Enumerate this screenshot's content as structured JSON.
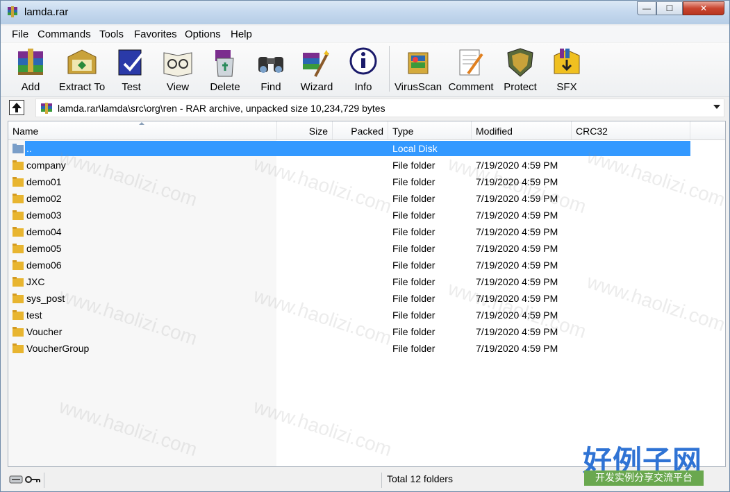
{
  "window": {
    "title": "lamda.rar"
  },
  "menu": [
    "File",
    "Commands",
    "Tools",
    "Favorites",
    "Options",
    "Help"
  ],
  "toolbar": [
    {
      "label": "Add",
      "icon": "add-icon"
    },
    {
      "label": "Extract To",
      "icon": "extract-icon"
    },
    {
      "label": "Test",
      "icon": "test-icon"
    },
    {
      "label": "View",
      "icon": "view-icon"
    },
    {
      "label": "Delete",
      "icon": "delete-icon"
    },
    {
      "label": "Find",
      "icon": "find-icon"
    },
    {
      "label": "Wizard",
      "icon": "wizard-icon"
    },
    {
      "label": "Info",
      "icon": "info-icon"
    },
    {
      "label": "VirusScan",
      "icon": "virusscan-icon"
    },
    {
      "label": "Comment",
      "icon": "comment-icon"
    },
    {
      "label": "Protect",
      "icon": "protect-icon"
    },
    {
      "label": "SFX",
      "icon": "sfx-icon"
    }
  ],
  "address": {
    "path": "lamda.rar\\lamda\\src\\org\\ren - RAR archive, unpacked size 10,234,729 bytes"
  },
  "columns": [
    "Name",
    "Size",
    "Packed",
    "Type",
    "Modified",
    "CRC32"
  ],
  "rows": [
    {
      "name": "..",
      "type": "Local Disk",
      "modified": "",
      "selected": true
    },
    {
      "name": "company",
      "type": "File folder",
      "modified": "7/19/2020 4:59 PM"
    },
    {
      "name": "demo01",
      "type": "File folder",
      "modified": "7/19/2020 4:59 PM"
    },
    {
      "name": "demo02",
      "type": "File folder",
      "modified": "7/19/2020 4:59 PM"
    },
    {
      "name": "demo03",
      "type": "File folder",
      "modified": "7/19/2020 4:59 PM"
    },
    {
      "name": "demo04",
      "type": "File folder",
      "modified": "7/19/2020 4:59 PM"
    },
    {
      "name": "demo05",
      "type": "File folder",
      "modified": "7/19/2020 4:59 PM"
    },
    {
      "name": "demo06",
      "type": "File folder",
      "modified": "7/19/2020 4:59 PM"
    },
    {
      "name": "JXC",
      "type": "File folder",
      "modified": "7/19/2020 4:59 PM"
    },
    {
      "name": "sys_post",
      "type": "File folder",
      "modified": "7/19/2020 4:59 PM"
    },
    {
      "name": "test",
      "type": "File folder",
      "modified": "7/19/2020 4:59 PM"
    },
    {
      "name": "Voucher",
      "type": "File folder",
      "modified": "7/19/2020 4:59 PM"
    },
    {
      "name": "VoucherGroup",
      "type": "File folder",
      "modified": "7/19/2020 4:59 PM"
    }
  ],
  "status": {
    "summary": "Total 12 folders"
  },
  "watermark": {
    "text": "www.haolizi.com",
    "logo": "好例子网",
    "tagline": "开发实例分享交流平台"
  },
  "colors": {
    "selection": "#3399ff",
    "folder": "#e8b530",
    "logo": "#2f73d4",
    "tagline_bg": "#6aa84f"
  }
}
